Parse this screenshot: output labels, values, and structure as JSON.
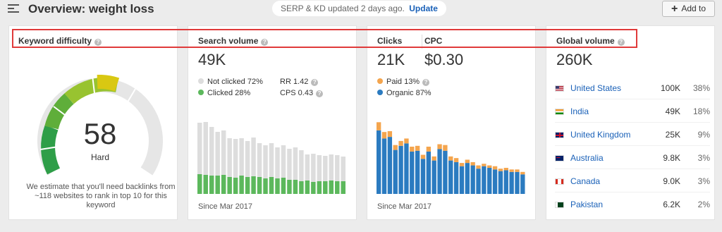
{
  "header": {
    "menu_icon": "hamburger-icon",
    "title": "Overview: weight loss",
    "notice_text": "SERP & KD updated 2 days ago.",
    "notice_link": "Update",
    "add_button": "Add to"
  },
  "keyword_difficulty": {
    "title": "Keyword difficulty",
    "value": "58",
    "label": "Hard",
    "description": "We estimate that you'll need backlinks from ~118 websites to rank in top 10 for this keyword",
    "score_fraction": 0.58,
    "colors": [
      "#2e9e48",
      "#8cc43c",
      "#d6cc17"
    ]
  },
  "search_volume": {
    "title": "Search volume",
    "value": "49K",
    "not_clicked": "Not clicked 72%",
    "clicked": "Clicked 28%",
    "rr": "RR 1.42",
    "cps": "CPS 0.43",
    "since": "Since Mar 2017",
    "colors": {
      "not_clicked": "#dddddd",
      "clicked": "#5cb85c"
    }
  },
  "clicks": {
    "title": "Clicks",
    "value": "21K",
    "cpc_title": "CPC",
    "cpc_value": "$0.30",
    "paid": "Paid 13%",
    "organic": "Organic 87%",
    "since": "Since Mar 2017",
    "colors": {
      "paid": "#f4a54e",
      "organic": "#2b7bc0"
    }
  },
  "global_volume": {
    "title": "Global volume",
    "value": "260K",
    "countries": [
      {
        "name": "United States",
        "volume": "100K",
        "percent": "38%",
        "flag": "us"
      },
      {
        "name": "India",
        "volume": "49K",
        "percent": "18%",
        "flag": "in"
      },
      {
        "name": "United Kingdom",
        "volume": "25K",
        "percent": "9%",
        "flag": "gb"
      },
      {
        "name": "Australia",
        "volume": "9.8K",
        "percent": "3%",
        "flag": "au"
      },
      {
        "name": "Canada",
        "volume": "9.0K",
        "percent": "3%",
        "flag": "ca"
      },
      {
        "name": "Pakistan",
        "volume": "6.2K",
        "percent": "2%",
        "flag": "pk"
      }
    ]
  },
  "chart_data": [
    {
      "type": "bar",
      "chart": "search-volume",
      "series": [
        {
          "name": "Clicked",
          "values": [
            28,
            27,
            26,
            26,
            27,
            24,
            23,
            26,
            24,
            25,
            24,
            22,
            24,
            22,
            23,
            20,
            20,
            18,
            19,
            17,
            18,
            18,
            19,
            18,
            18
          ]
        },
        {
          "name": "Not clicked",
          "values": [
            73,
            75,
            69,
            62,
            63,
            55,
            55,
            53,
            51,
            55,
            48,
            47,
            48,
            44,
            46,
            44,
            46,
            44,
            37,
            40,
            37,
            36,
            37,
            37,
            35
          ]
        }
      ]
    },
    {
      "type": "bar",
      "chart": "clicks",
      "series": [
        {
          "name": "Organic",
          "values": [
            78,
            68,
            70,
            54,
            59,
            62,
            52,
            53,
            43,
            52,
            41,
            55,
            53,
            41,
            39,
            34,
            38,
            35,
            31,
            34,
            32,
            30,
            28,
            29,
            27,
            27,
            24
          ]
        },
        {
          "name": "Paid",
          "values": [
            10,
            8,
            7,
            6,
            6,
            6,
            6,
            6,
            5,
            6,
            5,
            6,
            7,
            5,
            5,
            4,
            4,
            4,
            4,
            3,
            3,
            4,
            3,
            3,
            3,
            3,
            3
          ]
        }
      ]
    }
  ]
}
